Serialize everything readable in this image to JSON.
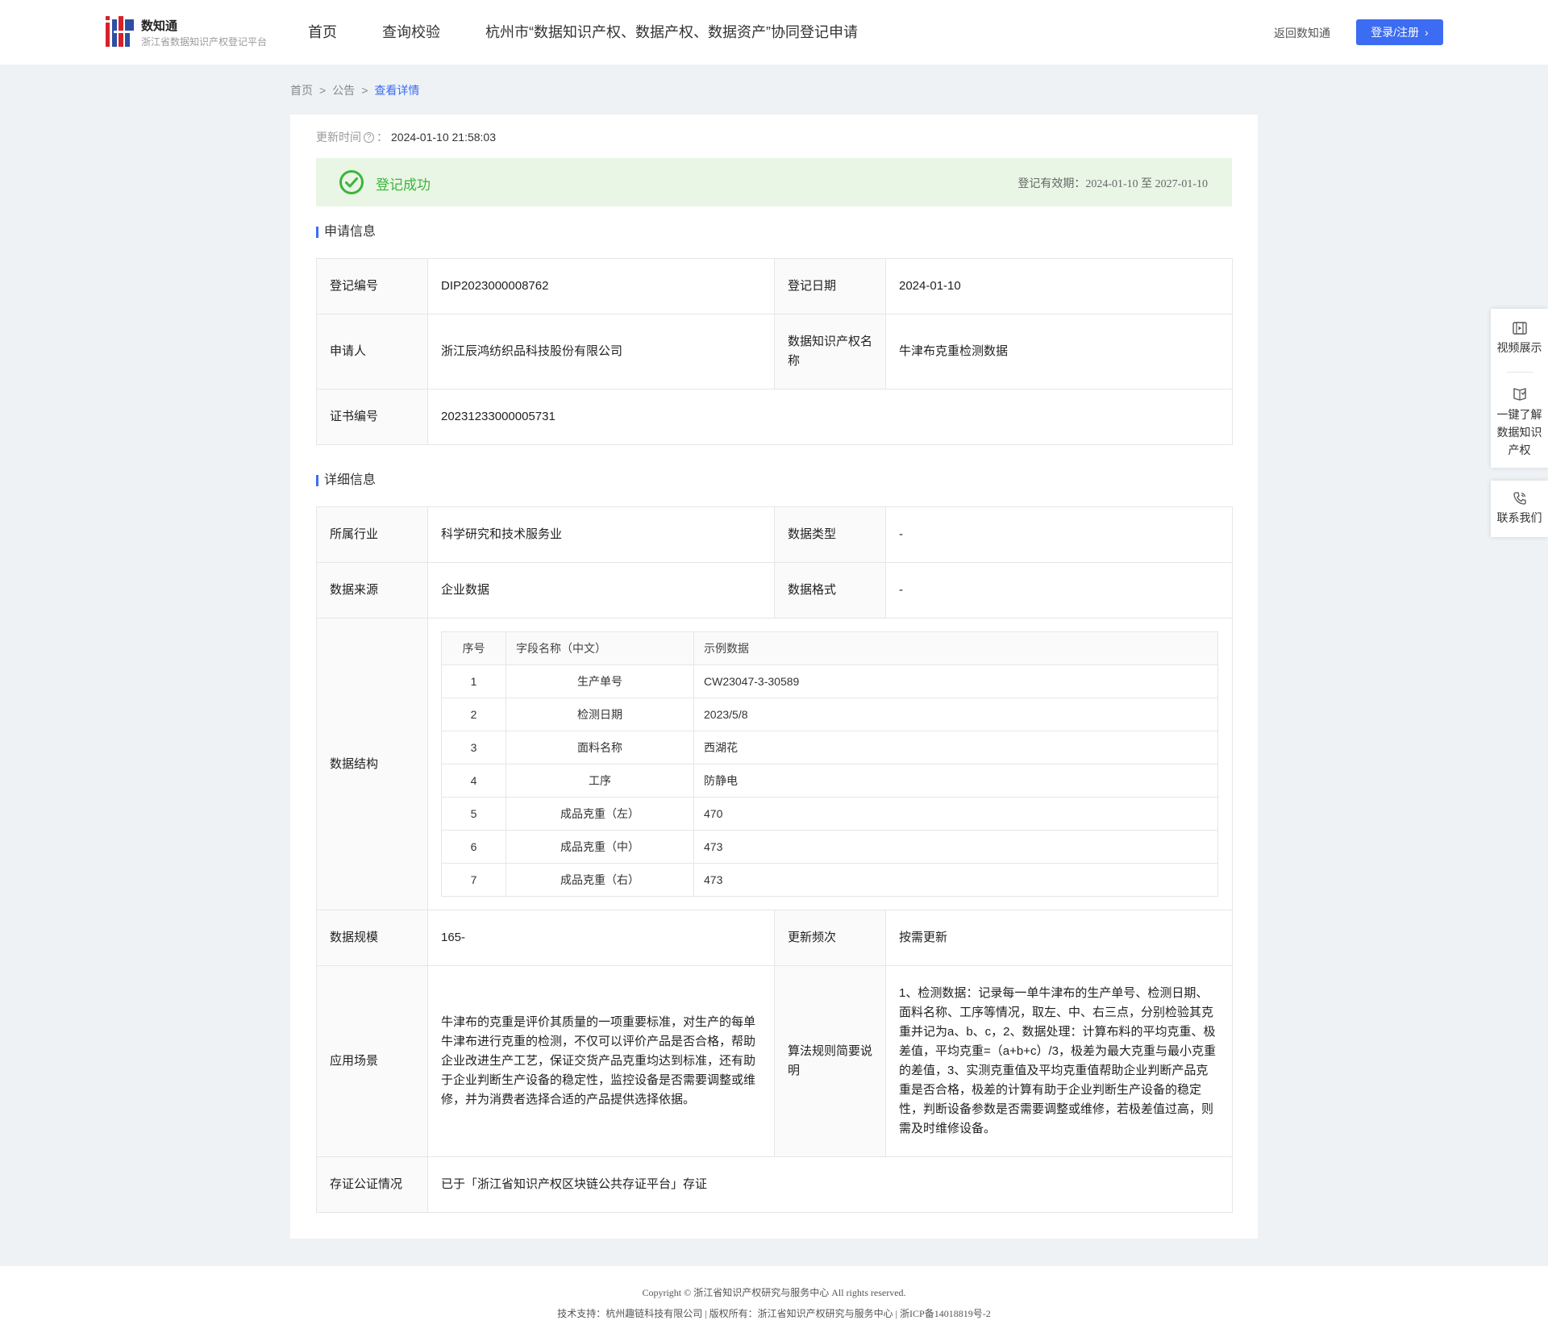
{
  "brand": {
    "name": "数知通",
    "subtitle": "浙江省数据知识产权登记平台"
  },
  "nav": {
    "home": "首页",
    "query": "查询校验",
    "apply": "杭州市“数据知识产权、数据产权、数据资产”协同登记申请",
    "back": "返回数知通",
    "login": "登录/注册"
  },
  "breadcrumb": {
    "home": "首页",
    "notice": "公告",
    "current": "查看详情",
    "sep": ">"
  },
  "update": {
    "label": "更新时间",
    "colon": "：",
    "value": "2024-01-10 21:58:03"
  },
  "status": {
    "text": "登记成功",
    "validity": "登记有效期：2024-01-10 至 2027-01-10",
    "color": "#3cb43c"
  },
  "application": {
    "title": "申请信息",
    "reg_no_label": "登记编号",
    "reg_no": "DIP2023000008762",
    "reg_date_label": "登记日期",
    "reg_date": "2024-01-10",
    "applicant_label": "申请人",
    "applicant": "浙江辰鸿纺织品科技股份有限公司",
    "ip_name_label": "数据知识产权名称",
    "ip_name": "牛津布克重检测数据",
    "cert_no_label": "证书编号",
    "cert_no": "20231233000005731"
  },
  "detail": {
    "title": "详细信息",
    "industry_label": "所属行业",
    "industry": "科学研究和技术服务业",
    "data_type_label": "数据类型",
    "data_type": "-",
    "source_label": "数据来源",
    "source": "企业数据",
    "format_label": "数据格式",
    "format": "-",
    "structure_label": "数据结构",
    "structure": {
      "headers": [
        "序号",
        "字段名称（中文）",
        "示例数据"
      ],
      "rows": [
        [
          "1",
          "生产单号",
          "CW23047-3-30589"
        ],
        [
          "2",
          "检测日期",
          "2023/5/8"
        ],
        [
          "3",
          "面料名称",
          "西湖花"
        ],
        [
          "4",
          "工序",
          "防静电"
        ],
        [
          "5",
          "成品克重（左）",
          "470"
        ],
        [
          "6",
          "成品克重（中）",
          "473"
        ],
        [
          "7",
          "成品克重（右）",
          "473"
        ]
      ]
    },
    "scale_label": "数据规模",
    "scale": "165-",
    "freq_label": "更新频次",
    "freq": "按需更新",
    "scenario_label": "应用场景",
    "scenario": "牛津布的克重是评价其质量的一项重要标准，对生产的每单牛津布进行克重的检测，不仅可以评价产品是否合格，帮助企业改进生产工艺，保证交货产品克重均达到标准，还有助于企业判断生产设备的稳定性，监控设备是否需要调整或维修，并为消费者选择合适的产品提供选择依据。",
    "algo_label": "算法规则简要说明",
    "algo": "1、检测数据：记录每一单牛津布的生产单号、检测日期、面料名称、工序等情况，取左、中、右三点，分别检验其克重并记为a、b、c，2、数据处理：计算布料的平均克重、极差值，平均克重=（a+b+c）/3，极差为最大克重与最小克重的差值，3、实测克重值及平均克重值帮助企业判断产品克重是否合格，极差的计算有助于企业判断生产设备的稳定性，判断设备参数是否需要调整或维修，若极差值过高，则需及时维修设备。",
    "evidence_label": "存证公证情况",
    "evidence": "已于「浙江省知识产权区块链公共存证平台」存证"
  },
  "side": {
    "video": "视频展示",
    "learn_1": "一键了解",
    "learn_2": "数据知识",
    "learn_3": "产权",
    "contact": "联系我们"
  },
  "footer": {
    "copyright": "Copyright © 浙江省知识产权研究与服务中心 All rights reserved.",
    "support": "技术支持：杭州趣链科技有限公司 | 版权所有：浙江省知识产权研究与服务中心 | 浙ICP备14018819号-2"
  },
  "colors": {
    "accent": "#3c6cf2",
    "success": "#3cb43c",
    "success_bg": "#e9f6e5"
  }
}
